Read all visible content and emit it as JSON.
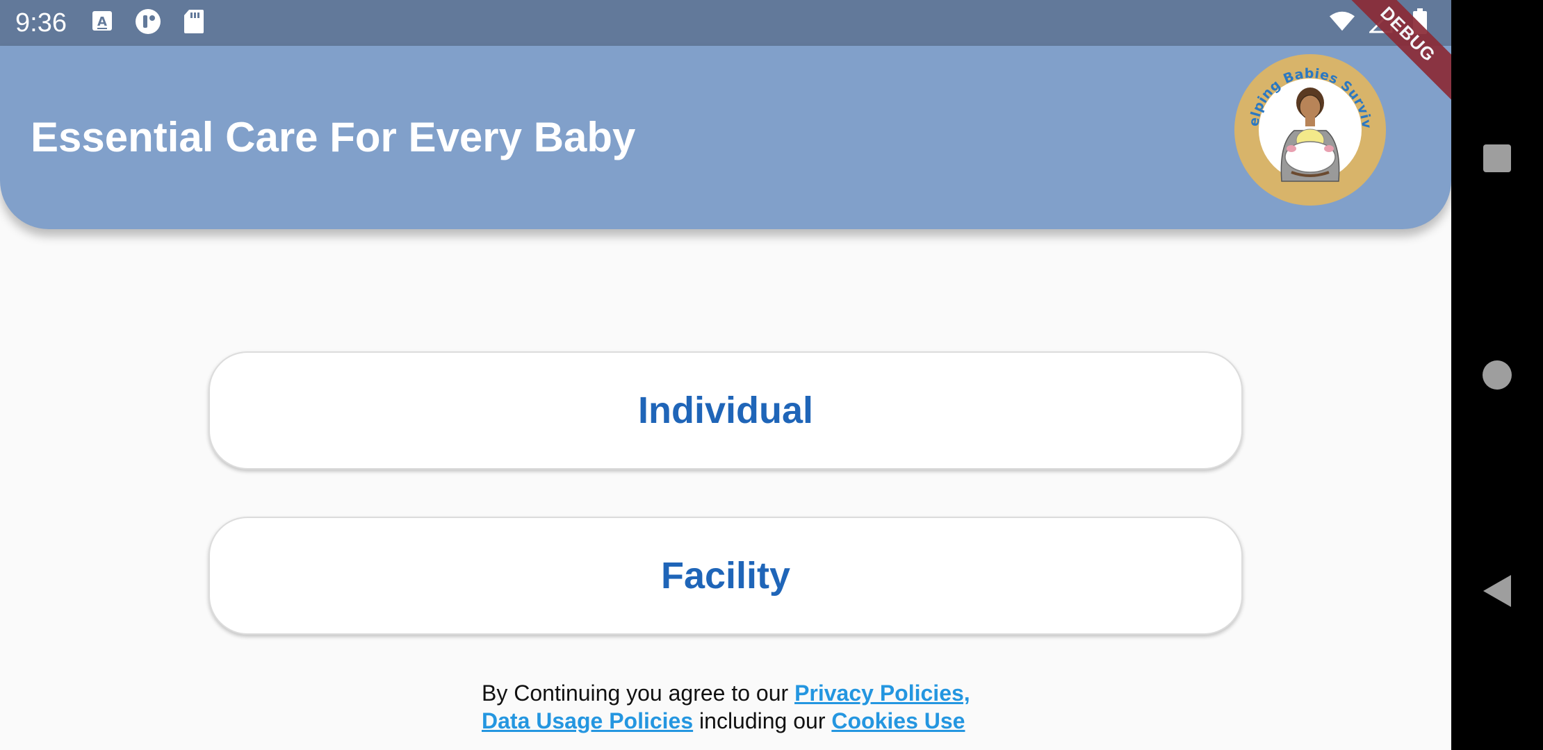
{
  "status_bar": {
    "time": "9:36",
    "left_icons": [
      "a-keyboard-icon",
      "chat-app-icon",
      "sd-card-icon"
    ],
    "right_icons": [
      "wifi-icon",
      "signal-icon",
      "battery-icon"
    ]
  },
  "app_bar": {
    "title": "Essential Care For Every Baby",
    "logo_text": "Helping Babies Survive",
    "color": "#81a0ca"
  },
  "debug_ribbon": "DEBUG",
  "choices": {
    "individual": "Individual",
    "facility": "Facility"
  },
  "legal": {
    "prefix": "By Continuing you agree to our",
    "privacy_link": "Privacy Policies,",
    "data_link": "Data Usage Policies",
    "middle": "including our",
    "cookies_link": "Cookies Use"
  },
  "colors": {
    "button_text": "#1f65b8",
    "link": "#2496e0",
    "status_bar": "#62799a"
  },
  "nav_bar": {
    "buttons": [
      "recents-square-icon",
      "home-circle-icon",
      "back-triangle-icon"
    ]
  }
}
